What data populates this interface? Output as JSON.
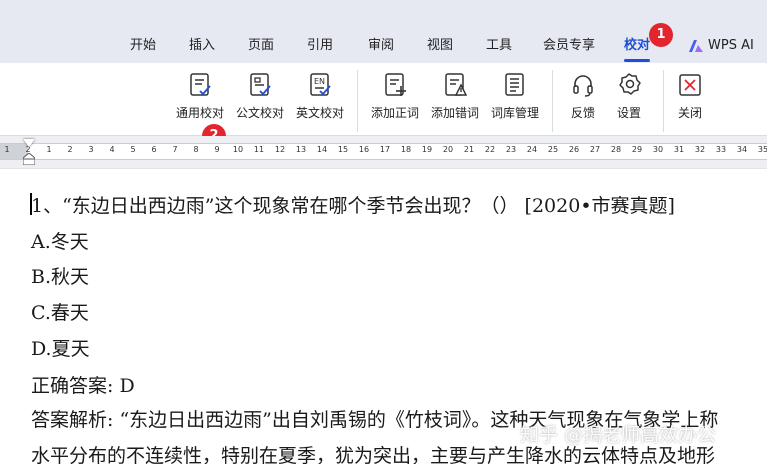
{
  "tabs": [
    {
      "label": "开始",
      "active": false
    },
    {
      "label": "插入",
      "active": false
    },
    {
      "label": "页面",
      "active": false
    },
    {
      "label": "引用",
      "active": false
    },
    {
      "label": "审阅",
      "active": false
    },
    {
      "label": "视图",
      "active": false
    },
    {
      "label": "工具",
      "active": false
    },
    {
      "label": "会员专享",
      "active": false
    },
    {
      "label": "校对",
      "active": true
    },
    {
      "label": "WPS AI",
      "active": false
    }
  ],
  "badges": [
    "1",
    "2"
  ],
  "ribbon": {
    "buttons": [
      {
        "label": "通用校对",
        "icon": "general-proofread-icon"
      },
      {
        "label": "公文校对",
        "icon": "official-doc-proofread-icon"
      },
      {
        "label": "英文校对",
        "icon": "english-proofread-icon"
      },
      {
        "label": "添加正词",
        "icon": "add-correct-word-icon"
      },
      {
        "label": "添加错词",
        "icon": "add-wrong-word-icon"
      },
      {
        "label": "词库管理",
        "icon": "lexicon-manage-icon"
      },
      {
        "label": "反馈",
        "icon": "headset-icon"
      },
      {
        "label": "设置",
        "icon": "gear-icon"
      },
      {
        "label": "关闭",
        "icon": "close-icon"
      }
    ],
    "en_icon_text": "EN"
  },
  "ruler": {
    "ticks": [
      "1",
      "2",
      "1",
      "2",
      "3",
      "4",
      "5",
      "6",
      "7",
      "8",
      "9",
      "10",
      "11",
      "12",
      "13",
      "14",
      "15",
      "16",
      "17",
      "18",
      "19",
      "20",
      "21",
      "22",
      "23",
      "24",
      "25",
      "26",
      "27",
      "28",
      "29",
      "30",
      "31",
      "32",
      "33",
      "34",
      "35"
    ]
  },
  "document": {
    "lines": [
      "1、“东边日出西边雨”这个现象常在哪个季节会出现？（） [2020•市赛真题]",
      "A.冬天",
      "B.秋天",
      "C.春天",
      "D.夏天",
      "正确答案: D",
      "答案解析: “东边日出西边雨”出自刘禹锡的《竹枝词》。这种天气现象在气象学上称",
      "水平分布的不连续性，特别在夏季，犹为突出，主要与产生降水的云体特点及地形"
    ]
  },
  "watermark": "知乎 @揭老师高效办公",
  "colors": {
    "accent": "#1f4fd6",
    "badge": "#e3262d",
    "ai_logo": "#4b5cf5"
  }
}
